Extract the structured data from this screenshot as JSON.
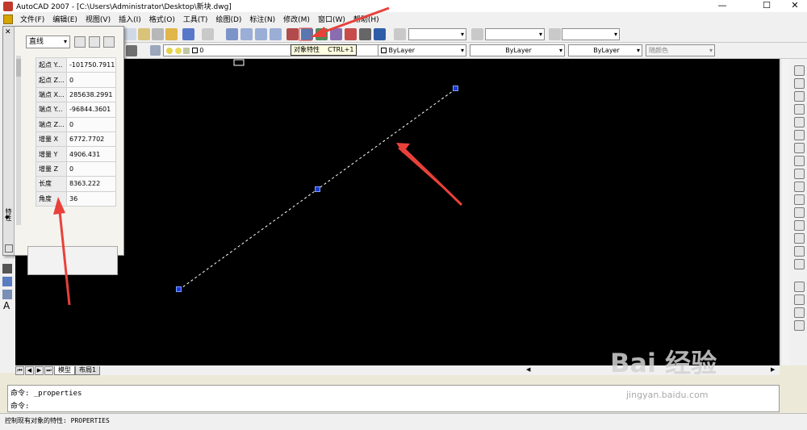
{
  "window": {
    "title": "AutoCAD 2007 - [C:\\Users\\Administrator\\Desktop\\新块.dwg]",
    "min_glyph": "—",
    "max_glyph": "☐",
    "close_glyph": "✕"
  },
  "menu": [
    "文件(F)",
    "编辑(E)",
    "视图(V)",
    "插入(I)",
    "格式(O)",
    "工具(T)",
    "绘图(D)",
    "标注(N)",
    "修改(M)",
    "窗口(W)",
    "帮助(H)"
  ],
  "toolbar": {
    "tooltip_label": "对象特性",
    "tooltip_shortcut": "CTRL+1",
    "layer_value": "0",
    "color_combo": "ByLayer",
    "linetype_combo": "ByLayer",
    "lineweight_combo": "ByLayer",
    "plotstyle_combo": "随颜色"
  },
  "palette": {
    "object_type": "直线",
    "side_label": "特性",
    "rows": [
      {
        "key": "起点 Y...",
        "value": "-101750.7911"
      },
      {
        "key": "起点 Z...",
        "value": "0"
      },
      {
        "key": "端点 X...",
        "value": "285638.2991"
      },
      {
        "key": "端点 Y...",
        "value": "-96844.3601"
      },
      {
        "key": "端点 Z...",
        "value": "0"
      },
      {
        "key": "增量 X",
        "value": "6772.7702"
      },
      {
        "key": "增量 Y",
        "value": "4906.431"
      },
      {
        "key": "增量 Z",
        "value": "0"
      },
      {
        "key": "长度",
        "value": "8363.222"
      },
      {
        "key": "角度",
        "value": "36"
      }
    ]
  },
  "tabs": {
    "model": "模型",
    "layout": "布局1"
  },
  "command": {
    "line1": "命令: _properties",
    "line2": "命令:"
  },
  "status": "控制现有对象的特性: PROPERTIES",
  "watermark": {
    "brand": "Bai  经验",
    "url": "jingyan.baidu.com"
  },
  "colors": {
    "canvas": "#000000",
    "grip": "#1d3bd6",
    "annotation_arrow": "#e8413a"
  }
}
